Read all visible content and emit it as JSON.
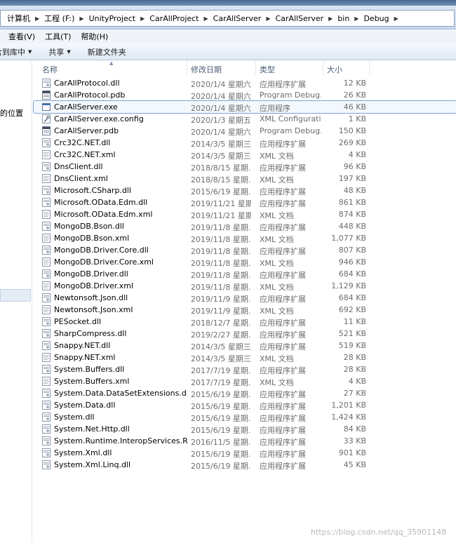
{
  "breadcrumb": [
    "计算机",
    "工程 (F:)",
    "UnityProject",
    "CarAllProject",
    "CarAllServer",
    "CarAllServer",
    "bin",
    "Debug"
  ],
  "menu": [
    "查看(V)",
    "工具(T)",
    "帮助(H)"
  ],
  "commands": [
    {
      "label": "含到库中",
      "dropdown": true
    },
    {
      "label": "共享",
      "dropdown": true
    },
    {
      "label": "新建文件夹",
      "dropdown": false
    }
  ],
  "nav": {
    "partial_label": "的位置"
  },
  "columns": {
    "name": "名称",
    "date": "修改日期",
    "type": "类型",
    "size": "大小"
  },
  "selected_index": 2,
  "files": [
    {
      "name": "CarAllProtocol.dll",
      "date": "2020/1/4 星期六 ...",
      "type": "应用程序扩展",
      "size": "12 KB",
      "icon": "dll-icon"
    },
    {
      "name": "CarAllProtocol.pdb",
      "date": "2020/1/4 星期六 ...",
      "type": "Program Debug...",
      "size": "26 KB",
      "icon": "pdb-icon"
    },
    {
      "name": "CarAllServer.exe",
      "date": "2020/1/4 星期六 ...",
      "type": "应用程序",
      "size": "46 KB",
      "icon": "exe-icon"
    },
    {
      "name": "CarAllServer.exe.config",
      "date": "2020/1/3 星期五 ...",
      "type": "XML Configurati...",
      "size": "1 KB",
      "icon": "config-icon"
    },
    {
      "name": "CarAllServer.pdb",
      "date": "2020/1/4 星期六 ...",
      "type": "Program Debug...",
      "size": "150 KB",
      "icon": "pdb-icon"
    },
    {
      "name": "Crc32C.NET.dll",
      "date": "2014/3/5 星期三 ...",
      "type": "应用程序扩展",
      "size": "269 KB",
      "icon": "dll-icon"
    },
    {
      "name": "Crc32C.NET.xml",
      "date": "2014/3/5 星期三 ...",
      "type": "XML 文档",
      "size": "4 KB",
      "icon": "xml-icon"
    },
    {
      "name": "DnsClient.dll",
      "date": "2018/8/15 星期...",
      "type": "应用程序扩展",
      "size": "96 KB",
      "icon": "dll-icon"
    },
    {
      "name": "DnsClient.xml",
      "date": "2018/8/15 星期...",
      "type": "XML 文档",
      "size": "197 KB",
      "icon": "xml-icon"
    },
    {
      "name": "Microsoft.CSharp.dll",
      "date": "2015/6/19 星期...",
      "type": "应用程序扩展",
      "size": "48 KB",
      "icon": "dll-icon"
    },
    {
      "name": "Microsoft.OData.Edm.dll",
      "date": "2019/11/21 星期...",
      "type": "应用程序扩展",
      "size": "861 KB",
      "icon": "dll-icon"
    },
    {
      "name": "Microsoft.OData.Edm.xml",
      "date": "2019/11/21 星期...",
      "type": "XML 文档",
      "size": "874 KB",
      "icon": "xml-icon"
    },
    {
      "name": "MongoDB.Bson.dll",
      "date": "2019/11/8 星期...",
      "type": "应用程序扩展",
      "size": "448 KB",
      "icon": "dll-icon"
    },
    {
      "name": "MongoDB.Bson.xml",
      "date": "2019/11/8 星期...",
      "type": "XML 文档",
      "size": "1,077 KB",
      "icon": "xml-icon"
    },
    {
      "name": "MongoDB.Driver.Core.dll",
      "date": "2019/11/8 星期...",
      "type": "应用程序扩展",
      "size": "807 KB",
      "icon": "dll-icon"
    },
    {
      "name": "MongoDB.Driver.Core.xml",
      "date": "2019/11/8 星期...",
      "type": "XML 文档",
      "size": "946 KB",
      "icon": "xml-icon"
    },
    {
      "name": "MongoDB.Driver.dll",
      "date": "2019/11/8 星期...",
      "type": "应用程序扩展",
      "size": "684 KB",
      "icon": "dll-icon"
    },
    {
      "name": "MongoDB.Driver.xml",
      "date": "2019/11/8 星期...",
      "type": "XML 文档",
      "size": "1,129 KB",
      "icon": "xml-icon"
    },
    {
      "name": "Newtonsoft.Json.dll",
      "date": "2019/11/9 星期...",
      "type": "应用程序扩展",
      "size": "684 KB",
      "icon": "dll-icon"
    },
    {
      "name": "Newtonsoft.Json.xml",
      "date": "2019/11/9 星期...",
      "type": "XML 文档",
      "size": "692 KB",
      "icon": "xml-icon"
    },
    {
      "name": "PESocket.dll",
      "date": "2018/12/7 星期...",
      "type": "应用程序扩展",
      "size": "11 KB",
      "icon": "dll-icon"
    },
    {
      "name": "SharpCompress.dll",
      "date": "2019/2/27 星期...",
      "type": "应用程序扩展",
      "size": "521 KB",
      "icon": "dll-icon"
    },
    {
      "name": "Snappy.NET.dll",
      "date": "2014/3/5 星期三 ...",
      "type": "应用程序扩展",
      "size": "519 KB",
      "icon": "dll-icon"
    },
    {
      "name": "Snappy.NET.xml",
      "date": "2014/3/5 星期三 ...",
      "type": "XML 文档",
      "size": "28 KB",
      "icon": "xml-icon"
    },
    {
      "name": "System.Buffers.dll",
      "date": "2017/7/19 星期...",
      "type": "应用程序扩展",
      "size": "28 KB",
      "icon": "dll-icon"
    },
    {
      "name": "System.Buffers.xml",
      "date": "2017/7/19 星期...",
      "type": "XML 文档",
      "size": "4 KB",
      "icon": "xml-icon"
    },
    {
      "name": "System.Data.DataSetExtensions.dll",
      "date": "2015/6/19 星期...",
      "type": "应用程序扩展",
      "size": "27 KB",
      "icon": "dll-icon"
    },
    {
      "name": "System.Data.dll",
      "date": "2015/6/19 星期...",
      "type": "应用程序扩展",
      "size": "1,201 KB",
      "icon": "dll-icon"
    },
    {
      "name": "System.dll",
      "date": "2015/6/19 星期...",
      "type": "应用程序扩展",
      "size": "1,424 KB",
      "icon": "dll-icon"
    },
    {
      "name": "System.Net.Http.dll",
      "date": "2015/6/19 星期...",
      "type": "应用程序扩展",
      "size": "84 KB",
      "icon": "dll-icon"
    },
    {
      "name": "System.Runtime.InteropServices.Runti...",
      "date": "2016/11/5 星期...",
      "type": "应用程序扩展",
      "size": "33 KB",
      "icon": "dll-icon"
    },
    {
      "name": "System.Xml.dll",
      "date": "2015/6/19 星期...",
      "type": "应用程序扩展",
      "size": "901 KB",
      "icon": "dll-icon"
    },
    {
      "name": "System.Xml.Linq.dll",
      "date": "2015/6/19 星期...",
      "type": "应用程序扩展",
      "size": "45 KB",
      "icon": "dll-icon"
    }
  ],
  "watermark": "https://blog.csdn.net/qq_35901148"
}
